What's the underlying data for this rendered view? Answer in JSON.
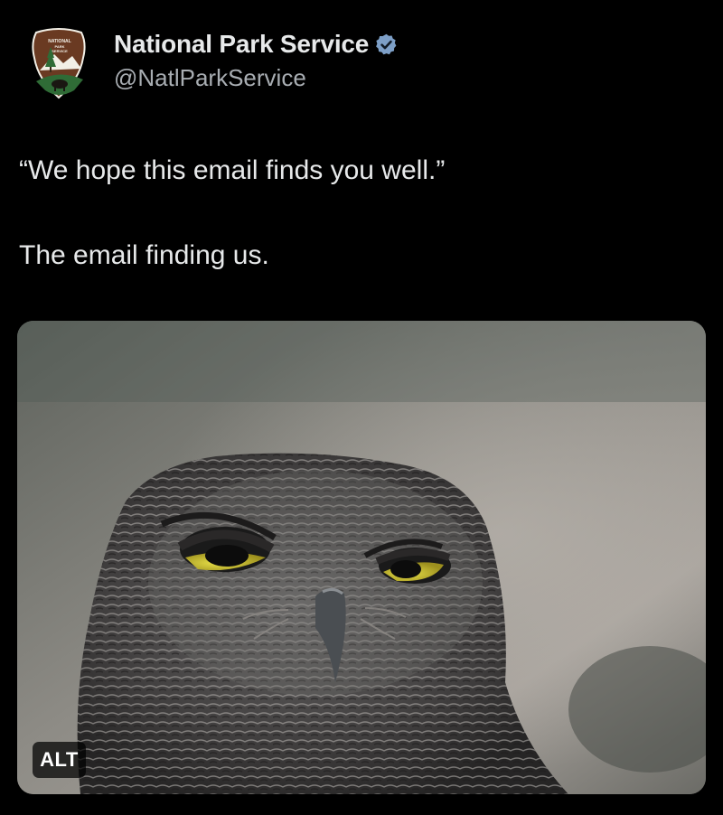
{
  "author": {
    "display_name": "National Park Service",
    "handle": "@NatlParkService",
    "verified": true,
    "verified_color": "#7d9fc7",
    "avatar_icon": "nps-arrowhead-logo-icon",
    "avatar_text": "NATIONAL PARK SERVICE"
  },
  "tweet": {
    "lines": [
      "“We hope this email finds you well.”",
      "The email finding us."
    ]
  },
  "media": {
    "alt_label": "ALT",
    "image_icon": "owl-photo-icon"
  },
  "colors": {
    "background": "#000000",
    "text": "#e7e9ea",
    "secondary_text": "#a8adb2",
    "badge_bg": "rgba(0,0,0,0.72)"
  }
}
